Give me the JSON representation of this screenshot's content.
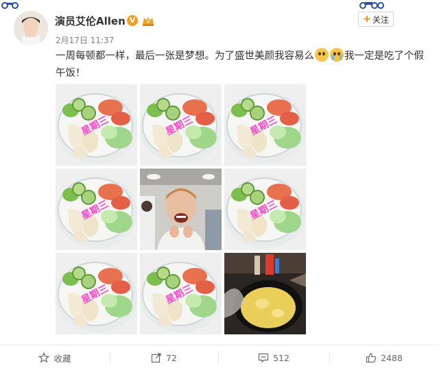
{
  "post": {
    "username": "演员艾伦Allen",
    "verified_badge": "V",
    "follow_label": "关注",
    "follow_plus": "+",
    "time": "2月17日 11:37",
    "text_part1": "一周每顿都一样，最后一张是梦想。为了盛世美颜我容易么",
    "text_part2": "我一定是吃了个假午饭！",
    "emoji_1": "fearful-face-icon",
    "emoji_2": "crying-face-icon"
  },
  "images": {
    "watermark": "星期三",
    "tiles": [
      {
        "kind": "salad"
      },
      {
        "kind": "salad"
      },
      {
        "kind": "salad"
      },
      {
        "kind": "salad"
      },
      {
        "kind": "person"
      },
      {
        "kind": "salad"
      },
      {
        "kind": "salad"
      },
      {
        "kind": "salad"
      },
      {
        "kind": "cooking"
      }
    ]
  },
  "toolbar": {
    "favorite_label": "收藏",
    "repost_count": "72",
    "comment_count": "512",
    "like_count": "2488"
  },
  "colors": {
    "accent": "#ff8200",
    "watermark": "#ff46c9",
    "vip_badge": "#f0a020"
  }
}
